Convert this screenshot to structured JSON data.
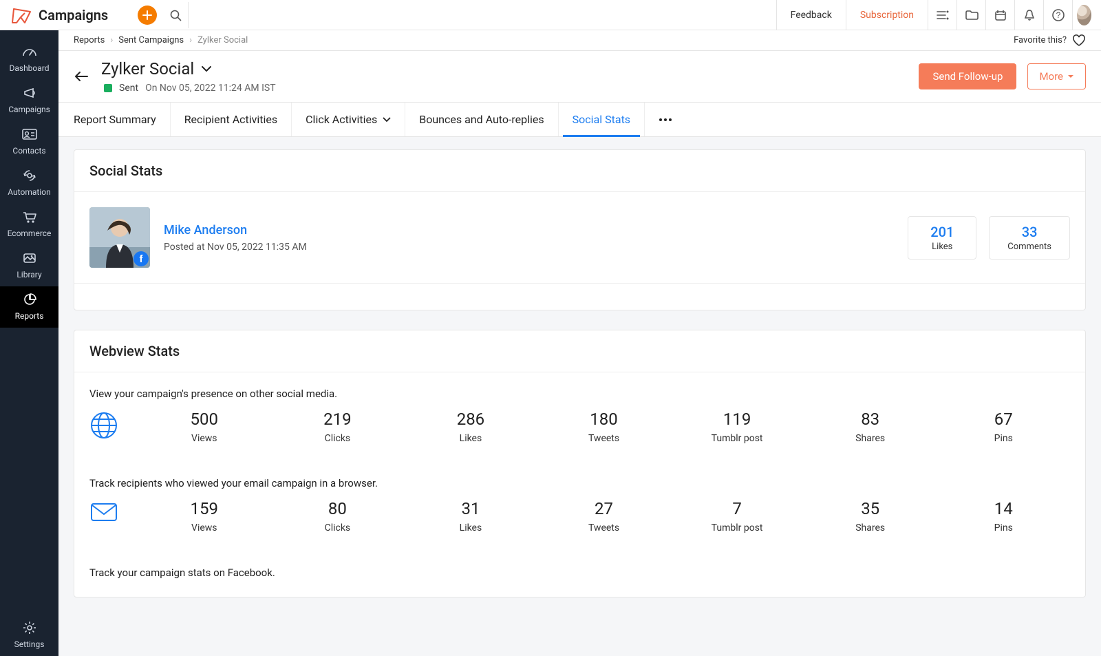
{
  "app": {
    "name": "Campaigns"
  },
  "header": {
    "feedback": "Feedback",
    "subscription": "Subscription"
  },
  "sidebar": {
    "items": [
      {
        "label": "Dashboard"
      },
      {
        "label": "Campaigns"
      },
      {
        "label": "Contacts"
      },
      {
        "label": "Automation"
      },
      {
        "label": "Ecommerce"
      },
      {
        "label": "Library"
      },
      {
        "label": "Reports"
      }
    ],
    "settings": "Settings"
  },
  "breadcrumb": {
    "a": "Reports",
    "b": "Sent Campaigns",
    "c": "Zylker Social",
    "favorite": "Favorite this?"
  },
  "page": {
    "title": "Zylker Social",
    "status": "Sent",
    "sent_on": "On Nov 05, 2022  11:24 AM IST",
    "follow_up": "Send Follow-up",
    "more": "More"
  },
  "tabs": {
    "summary": "Report Summary",
    "recipients": "Recipient Activities",
    "clicks": "Click Activities",
    "bounces": "Bounces and Auto-replies",
    "social": "Social Stats"
  },
  "social_stats": {
    "heading": "Social Stats",
    "poster_name": "Mike Anderson",
    "posted_at": "Posted at Nov 05, 2022  11:35 AM",
    "likes": {
      "value": "201",
      "label": "Likes"
    },
    "comments": {
      "value": "33",
      "label": "Comments"
    }
  },
  "webview": {
    "heading": "Webview Stats",
    "desc1": "View your campaign's presence on other social media.",
    "desc2": "Track recipients who viewed your email campaign in a browser.",
    "desc3": "Track your campaign stats on Facebook.",
    "labels": {
      "views": "Views",
      "clicks": "Clicks",
      "likes": "Likes",
      "tweets": "Tweets",
      "tumblr": "Tumblr post",
      "shares": "Shares",
      "pins": "Pins"
    },
    "row1": {
      "views": "500",
      "clicks": "219",
      "likes": "286",
      "tweets": "180",
      "tumblr": "119",
      "shares": "83",
      "pins": "67"
    },
    "row2": {
      "views": "159",
      "clicks": "80",
      "likes": "31",
      "tweets": "27",
      "tumblr": "7",
      "shares": "35",
      "pins": "14"
    }
  }
}
